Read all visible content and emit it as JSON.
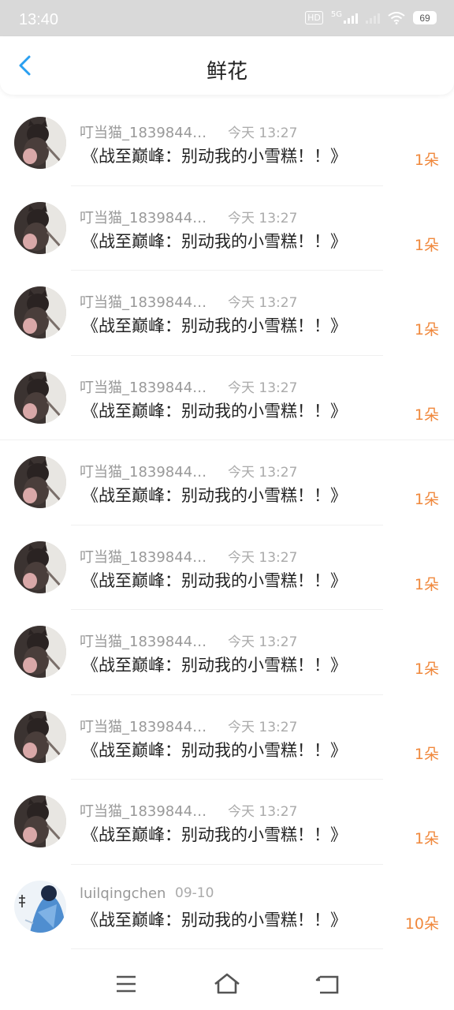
{
  "status_bar": {
    "time": "13:40",
    "hd": "HD",
    "network": "5G",
    "battery": "69"
  },
  "header": {
    "title": "鲜花"
  },
  "list": [
    {
      "name": "叮当猫_1839844…",
      "time": "今天 13:27",
      "book": "《战至巅峰：别动我的小雪糕！！》",
      "count": "1朵",
      "avatar": "cat"
    },
    {
      "name": "叮当猫_1839844…",
      "time": "今天 13:27",
      "book": "《战至巅峰：别动我的小雪糕！！》",
      "count": "1朵",
      "avatar": "cat"
    },
    {
      "name": "叮当猫_1839844…",
      "time": "今天 13:27",
      "book": "《战至巅峰：别动我的小雪糕！！》",
      "count": "1朵",
      "avatar": "cat"
    },
    {
      "name": "叮当猫_1839844…",
      "time": "今天 13:27",
      "book": "《战至巅峰：别动我的小雪糕！！》",
      "count": "1朵",
      "avatar": "cat"
    },
    {
      "name": "叮当猫_1839844…",
      "time": "今天 13:27",
      "book": "《战至巅峰：别动我的小雪糕！！》",
      "count": "1朵",
      "avatar": "cat"
    },
    {
      "name": "叮当猫_1839844…",
      "time": "今天 13:27",
      "book": "《战至巅峰：别动我的小雪糕！！》",
      "count": "1朵",
      "avatar": "cat"
    },
    {
      "name": "叮当猫_1839844…",
      "time": "今天 13:27",
      "book": "《战至巅峰：别动我的小雪糕！！》",
      "count": "1朵",
      "avatar": "cat"
    },
    {
      "name": "叮当猫_1839844…",
      "time": "今天 13:27",
      "book": "《战至巅峰：别动我的小雪糕！！》",
      "count": "1朵",
      "avatar": "cat"
    },
    {
      "name": "叮当猫_1839844…",
      "time": "今天 13:27",
      "book": "《战至巅峰：别动我的小雪糕！！》",
      "count": "1朵",
      "avatar": "cat"
    },
    {
      "name": "luilqingchen",
      "time": "09-10",
      "book": "《战至巅峰：别动我的小雪糕！！》",
      "count": "10朵",
      "avatar": "blue"
    }
  ],
  "colors": {
    "accent": "#2a9ff0",
    "count": "#f0883c",
    "status_bg": "#d9d9d9"
  },
  "icons": {
    "back": "chevron-left-icon",
    "menu": "menu-icon",
    "home": "home-icon",
    "return": "return-icon"
  }
}
